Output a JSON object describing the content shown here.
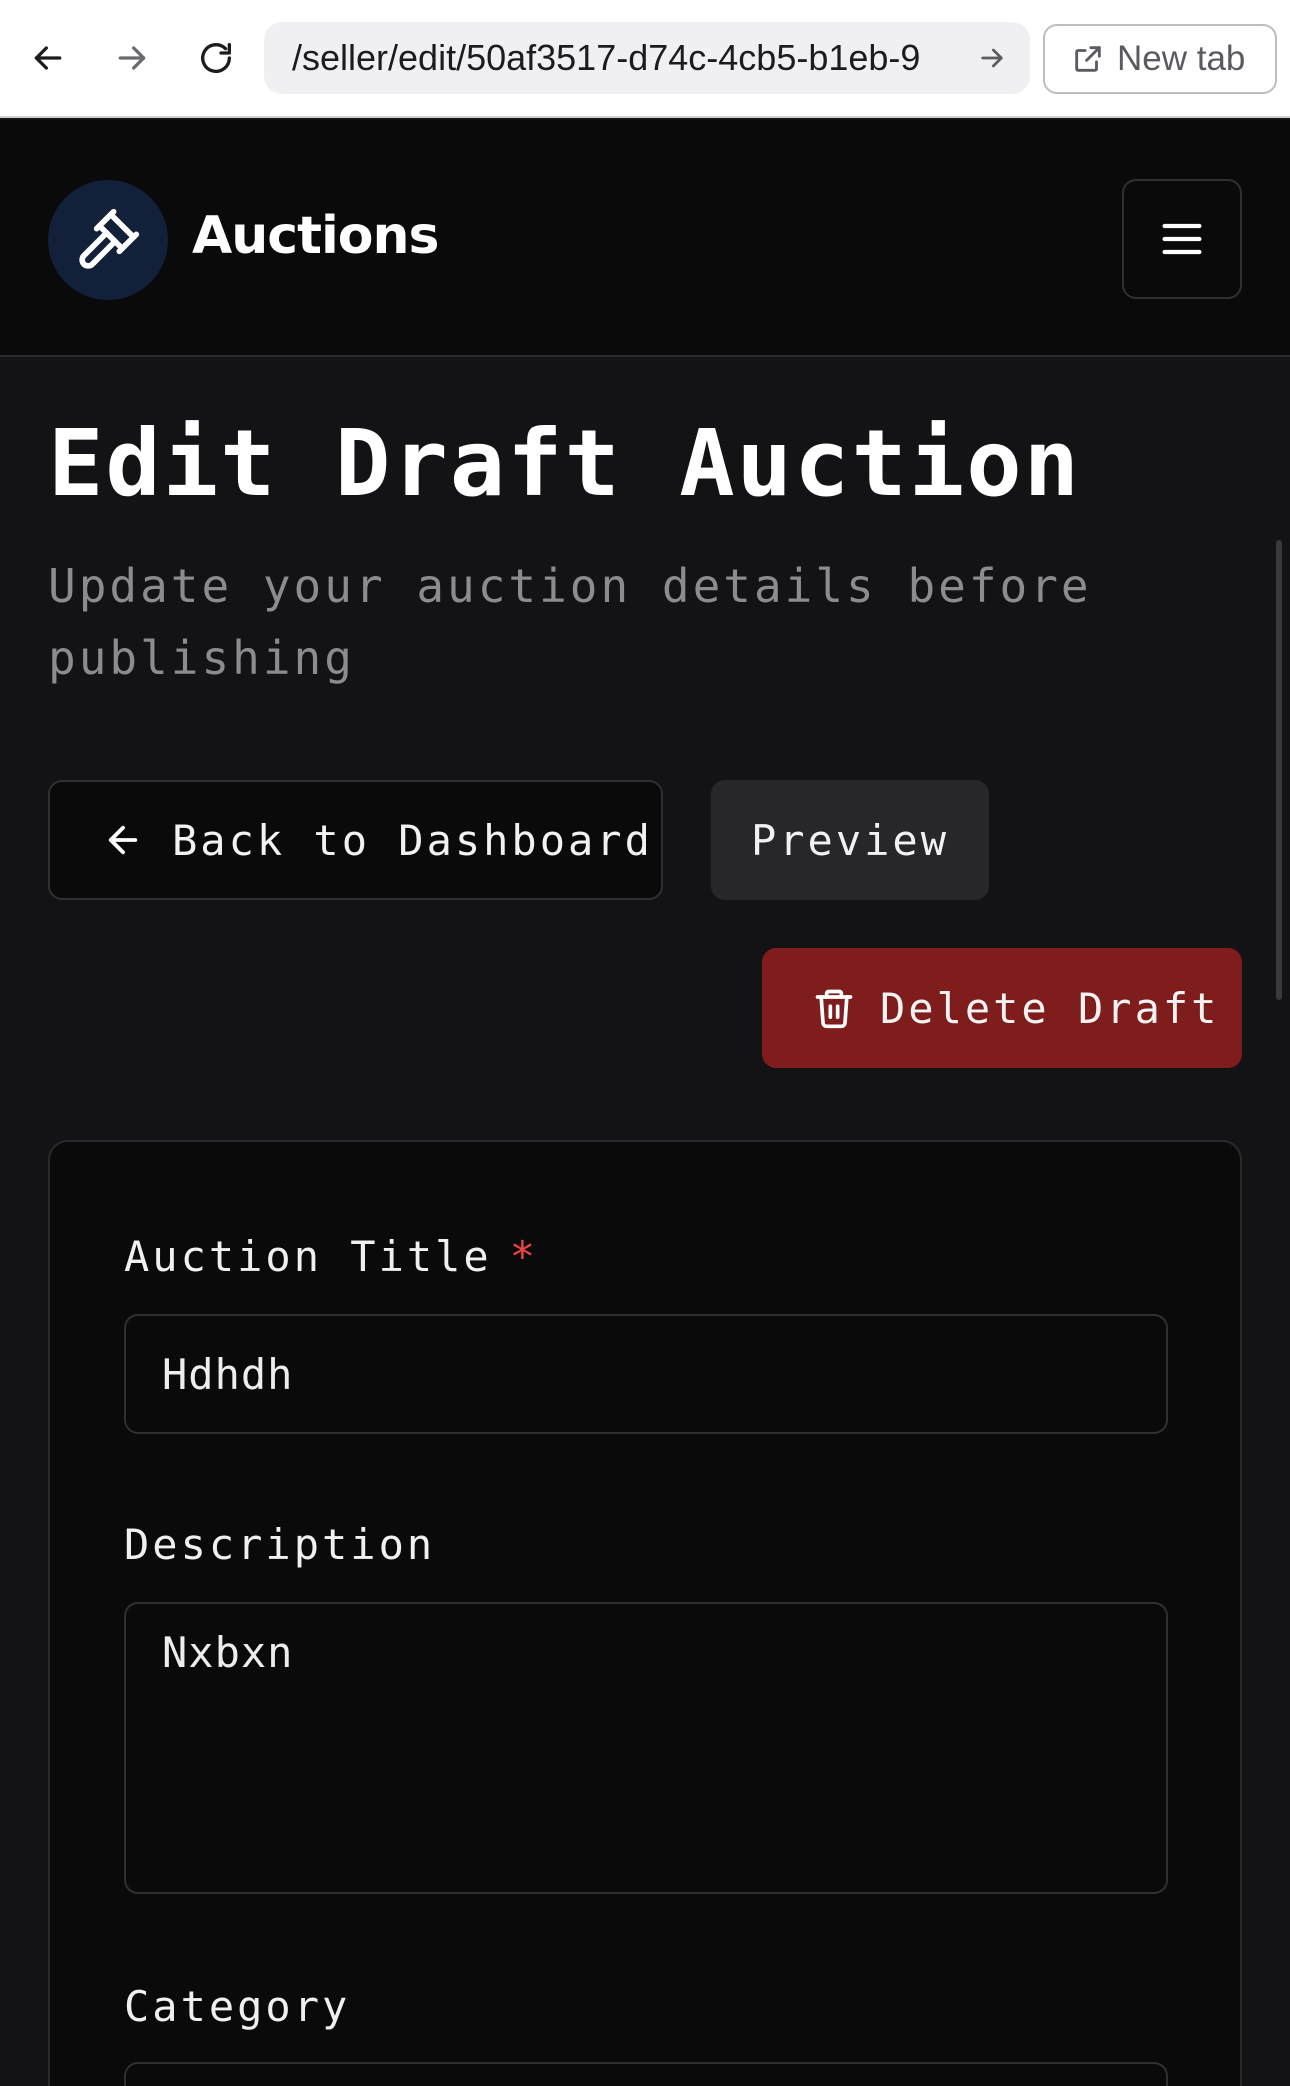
{
  "browser": {
    "url": "/seller/edit/50af3517-d74c-4cb5-b1eb-9",
    "new_tab_label": "New tab"
  },
  "header": {
    "brand": "Auctions"
  },
  "page": {
    "title": "Edit Draft Auction",
    "subtitle": "Update your auction details before publishing"
  },
  "actions": {
    "back_label": "Back to Dashboard",
    "preview_label": "Preview",
    "delete_label": "Delete Draft"
  },
  "form": {
    "title_label": "Auction Title",
    "required_mark": "*",
    "title_value": "Hdhdh",
    "description_label": "Description",
    "description_value": "Nxbxn",
    "category_label": "Category"
  },
  "colors": {
    "accent_danger": "#7f1d1d",
    "required": "#ef4444",
    "background": "#131315"
  }
}
